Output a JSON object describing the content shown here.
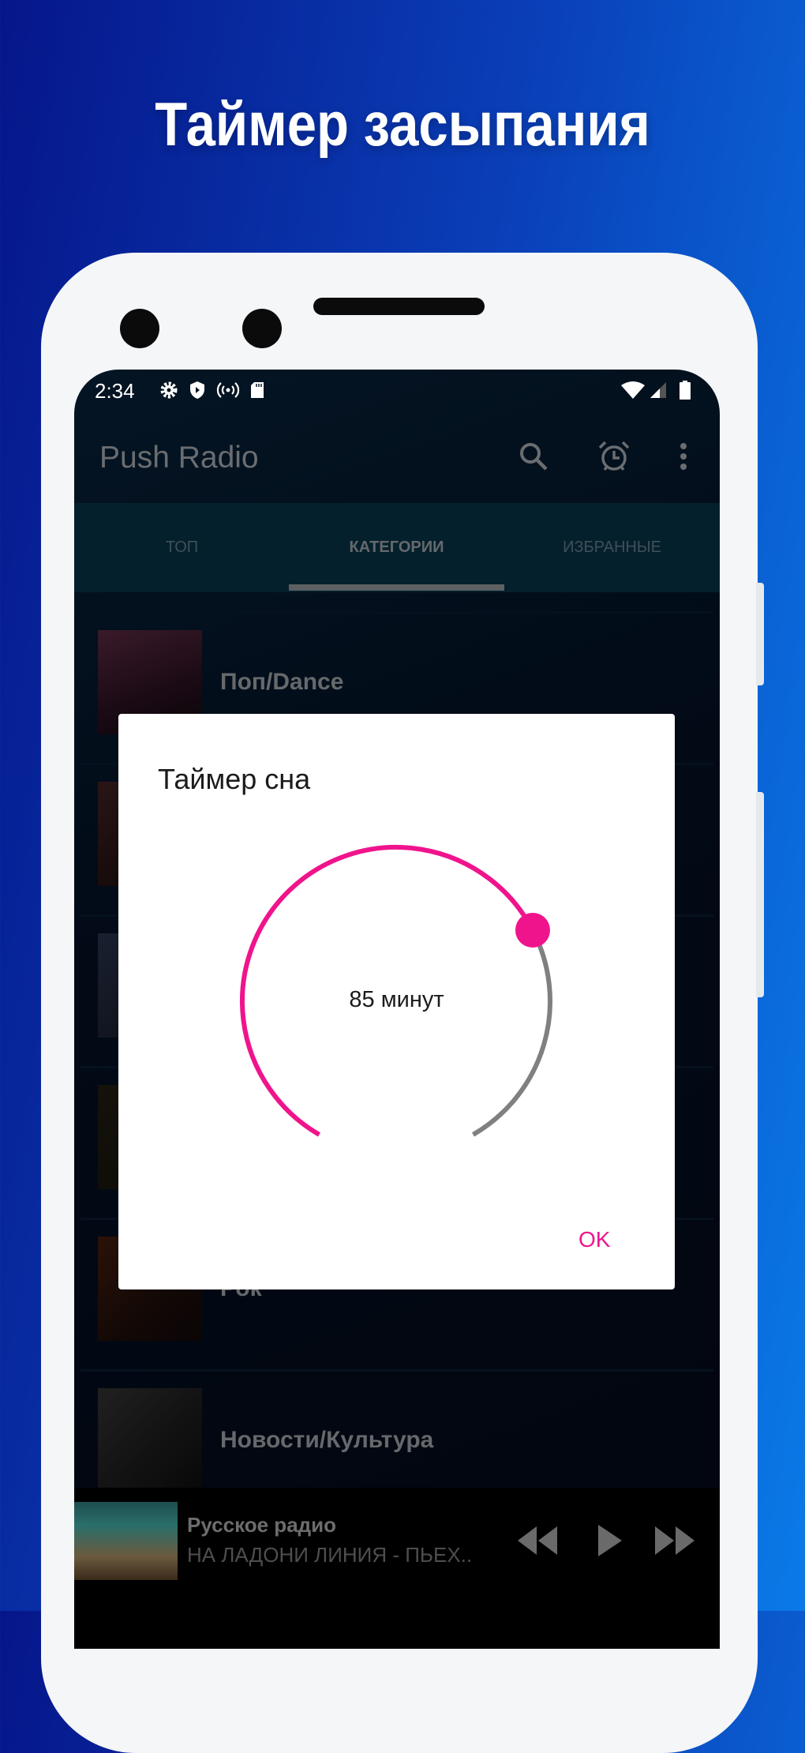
{
  "headline": "Таймер засыпания",
  "status_bar": {
    "time": "2:34",
    "icons": [
      "gear-icon",
      "shield-play-icon",
      "hotspot-icon",
      "sd-card-icon",
      "wifi-icon",
      "signal-icon",
      "battery-icon"
    ]
  },
  "app_bar": {
    "title": "Push Radio",
    "icons": [
      "search-icon",
      "alarm-icon",
      "more-vert-icon"
    ]
  },
  "tabs": [
    {
      "label": "ТОП",
      "active": false
    },
    {
      "label": "КАТЕГОРИИ",
      "active": true
    },
    {
      "label": "ИЗБРАННЫЕ",
      "active": false
    }
  ],
  "categories": [
    {
      "label": "Поп/Dance"
    },
    {
      "label": ""
    },
    {
      "label": ""
    },
    {
      "label": ""
    },
    {
      "label": "Рок"
    },
    {
      "label": "Новости/Культура"
    }
  ],
  "player": {
    "station": "Русское радио",
    "track": "НА ЛАДОНИ ЛИНИЯ - ПЬЕХ..",
    "controls": [
      "rewind-icon",
      "play-icon",
      "fast-forward-icon"
    ]
  },
  "dialog": {
    "title": "Таймер сна",
    "value_label": "85 минут",
    "value_minutes": 85,
    "max_minutes": 120,
    "ok_label": "OK"
  },
  "colors": {
    "accent": "#f0148c",
    "track": "#808080",
    "dialog_bg": "#ffffff"
  }
}
